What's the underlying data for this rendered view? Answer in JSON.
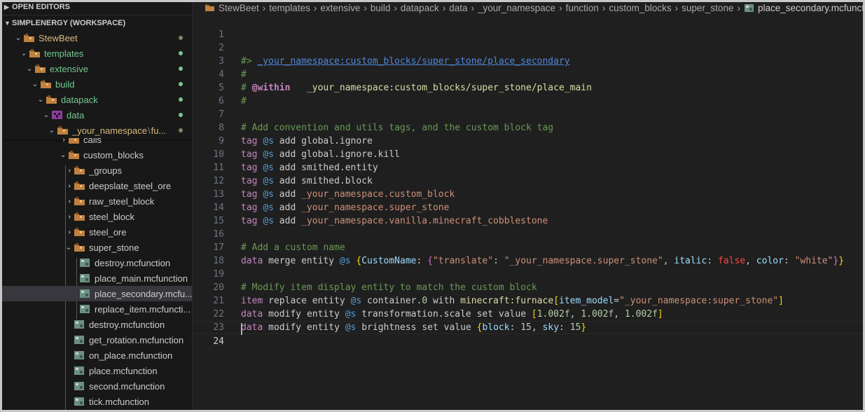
{
  "sidebar": {
    "open_editors": "OPEN EDITORS",
    "workspace": "SIMPLENERGY (WORKSPACE)",
    "tree": [
      {
        "label": "StewBeet"
      },
      {
        "label": "templates"
      },
      {
        "label": "extensive"
      },
      {
        "label": "build"
      },
      {
        "label": "datapack"
      },
      {
        "label": "data"
      },
      {
        "label": "_your_namespace",
        "label_suffix": "fu..."
      },
      {
        "label": "calls"
      },
      {
        "label": "custom_blocks"
      },
      {
        "label": "_groups"
      },
      {
        "label": "deepslate_steel_ore"
      },
      {
        "label": "raw_steel_block"
      },
      {
        "label": "steel_block"
      },
      {
        "label": "steel_ore"
      },
      {
        "label": "super_stone"
      },
      {
        "label": "destroy.mcfunction"
      },
      {
        "label": "place_main.mcfunction"
      },
      {
        "label": "place_secondary.mcfu..."
      },
      {
        "label": "replace_item.mcfuncti..."
      },
      {
        "label": "destroy.mcfunction"
      },
      {
        "label": "get_rotation.mcfunction"
      },
      {
        "label": "on_place.mcfunction"
      },
      {
        "label": "place.mcfunction"
      },
      {
        "label": "second.mcfunction"
      },
      {
        "label": "tick.mcfunction"
      }
    ]
  },
  "breadcrumb": [
    "StewBeet",
    "templates",
    "extensive",
    "build",
    "datapack",
    "data",
    "_your_namespace",
    "function",
    "custom_blocks",
    "super_stone",
    "place_secondary.mcfunction"
  ],
  "editor": {
    "line_numbers": [
      "1",
      "2",
      "3",
      "4",
      "5",
      "6",
      "7",
      "8",
      "9",
      "10",
      "11",
      "12",
      "13",
      "14",
      "15",
      "16",
      "17",
      "18",
      "19",
      "20",
      "21",
      "22",
      "23",
      "24"
    ],
    "lines": {
      "l2_prefix": "#>",
      "l2_path": "_your_namespace:custom_blocks/super_stone/place_secondary",
      "l3": "#",
      "l4_hash": "#",
      "l4_within": "@within",
      "l4_path": "_your_namespace:custom_blocks/super_stone/place_main",
      "l5": "#",
      "l7": "# Add convention and utils tags, and the custom block tag",
      "cmd_tag": "tag",
      "sel_s": "@s",
      "kw_add": "add",
      "l8_arg": "global.ignore",
      "l9_arg": "global.ignore.kill",
      "l10_arg": "smithed.entity",
      "l11_arg": "smithed.block",
      "l12_arg": "_your_namespace.custom_block",
      "l13_arg": "_your_namespace.super_stone",
      "l14_arg": "_your_namespace.vanilla.minecraft_cobblestone",
      "l16": "# Add a custom name",
      "cmd_data": "data",
      "l17_merge": "merge",
      "kw_entity": "entity",
      "l17_brace_open": "{",
      "l17_key_name": "CustomName",
      "colon": ":",
      "l17_inner_open": "{",
      "l17_translate_key": "\"translate\"",
      "l17_translate_val": "\"_your_namespace.super_stone\"",
      "comma": ",",
      "l17_italic": "italic",
      "l17_false": "false",
      "l17_color": "color",
      "l17_white": "\"white\"",
      "l17_inner_close": "}",
      "l17_brace_close": "}",
      "l19": "# Modify item display entity to match the custom block",
      "cmd_item": "item",
      "l20_replace": "replace",
      "l20_container": "container",
      "l20_slot": ".0",
      "l20_with": "with",
      "l20_item": "minecraft:furnace",
      "l20_br_open": "[",
      "l20_component": "item_model",
      "l20_eq": "=",
      "l20_model": "\"_your_namespace:super_stone\"",
      "l20_br_close": "]",
      "kw_modify": "modify",
      "l21_path": "transformation.scale",
      "kw_set": "set",
      "kw_value": "value",
      "l21_open": "[",
      "l21_v1": "1.002f",
      "l21_v2": "1.002f",
      "l21_v3": "1.002f",
      "l21_close": "]",
      "l22_path": "brightness",
      "l22_open": "{",
      "l22_block": "block",
      "l22_block_val": "15",
      "l22_sky": "sky",
      "l22_sky_val": "15",
      "l22_close": "}"
    }
  },
  "colors": {
    "folder_brown": "#c0803f",
    "git_green": "#73c991",
    "nested_git": "#d7ba7d",
    "selected_row": "#37373d"
  }
}
